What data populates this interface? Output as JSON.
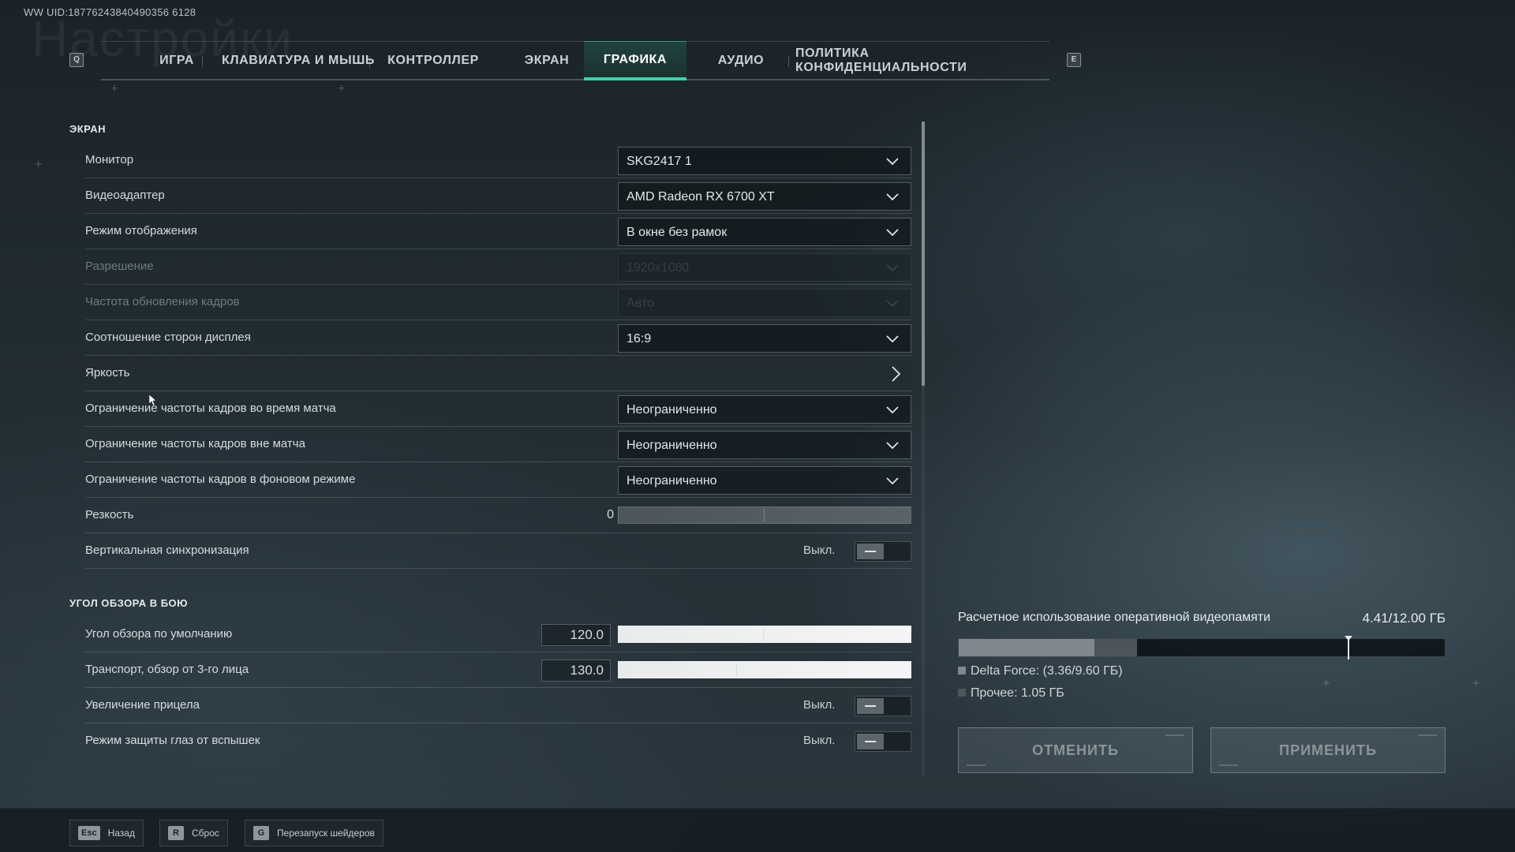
{
  "uid": "WW UID:18776243840490356 6128",
  "page_title": "Настройки",
  "tab_keys": {
    "prev": "Q",
    "next": "E"
  },
  "tabs": [
    {
      "label": "ИГРА"
    },
    {
      "label": "КЛАВИАТУРА И МЫШЬ"
    },
    {
      "label": "КОНТРОЛЛЕР"
    },
    {
      "label": "ЭКРАН"
    },
    {
      "label": "ГРАФИКА",
      "active": true
    },
    {
      "label": "АУДИО"
    },
    {
      "label": "ПОЛИТИКА КОНФИДЕНЦИАЛЬНОСТИ"
    }
  ],
  "screen_section": {
    "title": "ЭКРАН",
    "monitor": {
      "label": "Монитор",
      "value": "SKG2417 1"
    },
    "adapter": {
      "label": "Видеоадаптер",
      "value": "AMD Radeon RX 6700 XT"
    },
    "display_mode": {
      "label": "Режим отображения",
      "value": "В окне без рамок"
    },
    "resolution": {
      "label": "Разрешение",
      "value": "1920x1080"
    },
    "refresh_rate": {
      "label": "Частота обновления кадров",
      "value": "Авто"
    },
    "aspect": {
      "label": "Соотношение сторон дисплея",
      "value": "16:9"
    },
    "brightness": {
      "label": "Яркость"
    },
    "fps_match": {
      "label": "Ограничение частоты кадров во время матча",
      "value": "Неограниченно"
    },
    "fps_outside": {
      "label": "Ограничение частоты кадров вне матча",
      "value": "Неограниченно"
    },
    "fps_background": {
      "label": "Ограничение частоты кадров в фоновом режиме",
      "value": "Неограниченно"
    },
    "sharpness": {
      "label": "Резкость",
      "value": "0"
    },
    "vsync": {
      "label": "Вертикальная синхронизация",
      "state": "Выкл."
    }
  },
  "fov_section": {
    "title": "УГОЛ ОБЗОРА В БОЮ",
    "default_fov": {
      "label": "Угол обзора по умолчанию",
      "value": "120.0"
    },
    "vehicle_fov": {
      "label": "Транспорт, обзор от 3-го лица",
      "value": "130.0"
    },
    "scope_zoom": {
      "label": "Увеличение прицела",
      "state": "Выкл."
    },
    "flash_protect": {
      "label": "Режим защиты глаз от вспышек",
      "state": "Выкл."
    }
  },
  "vram": {
    "title": "Расчетное использование оперативной видеопамяти",
    "usage_text": "4.41/12.00 ГБ",
    "game_fraction": 0.28,
    "other_fraction": 0.0875,
    "budget_fraction": 0.8,
    "legend_game": "Delta Force: (3.36/9.60 ГБ)",
    "legend_other": "Прочее: 1.05 ГБ",
    "colors": {
      "game": "#7e888d",
      "other": "#4c5559"
    }
  },
  "buttons": {
    "cancel": "ОТМЕНИТЬ",
    "apply": "ПРИМЕНИТЬ"
  },
  "footer": {
    "back": {
      "key": "Esc",
      "label": "Назад"
    },
    "reset": {
      "key": "R",
      "label": "Сброс"
    },
    "shaders": {
      "key": "G",
      "label": "Перезапуск шейдеров"
    }
  }
}
